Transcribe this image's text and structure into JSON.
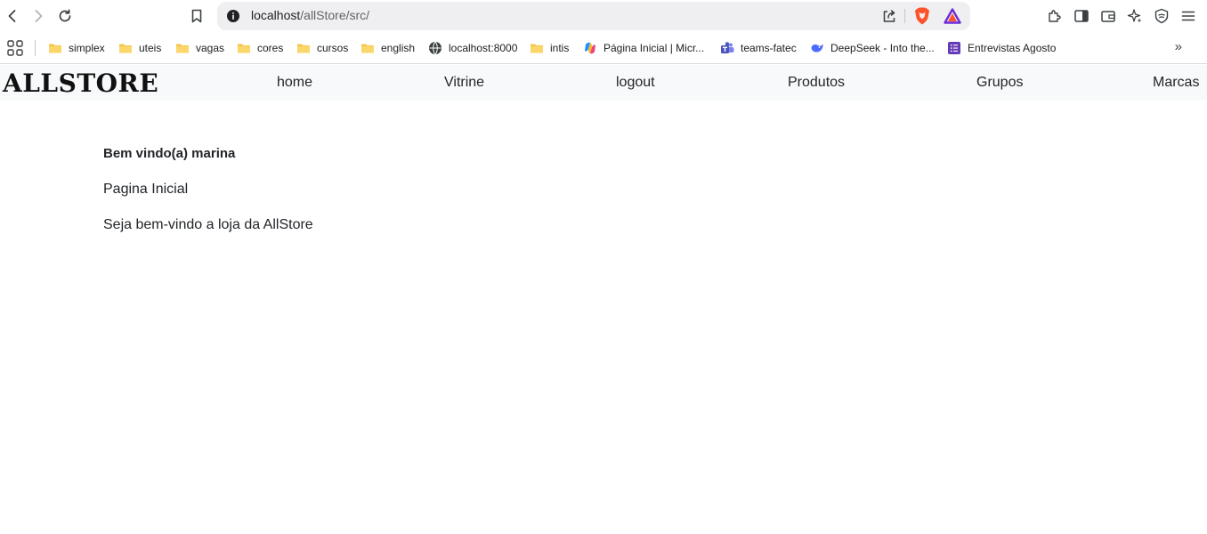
{
  "browser": {
    "url_host": "localhost",
    "url_path": "/allStore/src/",
    "bookmarks": [
      {
        "label": "simplex",
        "icon": "folder-icon"
      },
      {
        "label": "uteis",
        "icon": "folder-icon"
      },
      {
        "label": "vagas",
        "icon": "folder-icon"
      },
      {
        "label": "cores",
        "icon": "folder-icon"
      },
      {
        "label": "cursos",
        "icon": "folder-icon"
      },
      {
        "label": "english",
        "icon": "folder-icon"
      },
      {
        "label": "localhost:8000",
        "icon": "globe-icon"
      },
      {
        "label": "intis",
        "icon": "folder-icon"
      },
      {
        "label": "Página Inicial | Micr...",
        "icon": "copilot-icon"
      },
      {
        "label": "teams-fatec",
        "icon": "teams-icon"
      },
      {
        "label": "DeepSeek - Into the...",
        "icon": "deepseek-icon"
      },
      {
        "label": "Entrevistas Agosto",
        "icon": "forms-icon"
      }
    ],
    "more_label": "»"
  },
  "navbar": {
    "brand": "ALLSTORE",
    "links": [
      "home",
      "Vitrine",
      "logout",
      "Produtos",
      "Grupos",
      "Marcas"
    ]
  },
  "main": {
    "welcome": "Bem vindo(a) marina",
    "page_title": "Pagina Inicial",
    "message": "Seja bem-vindo a loja da AllStore"
  },
  "colors": {
    "navbar_bg": "#f8f9fa",
    "urlbar_bg": "#efeff2",
    "folder": "#f4c54a",
    "brave_orange": "#fb542b"
  }
}
